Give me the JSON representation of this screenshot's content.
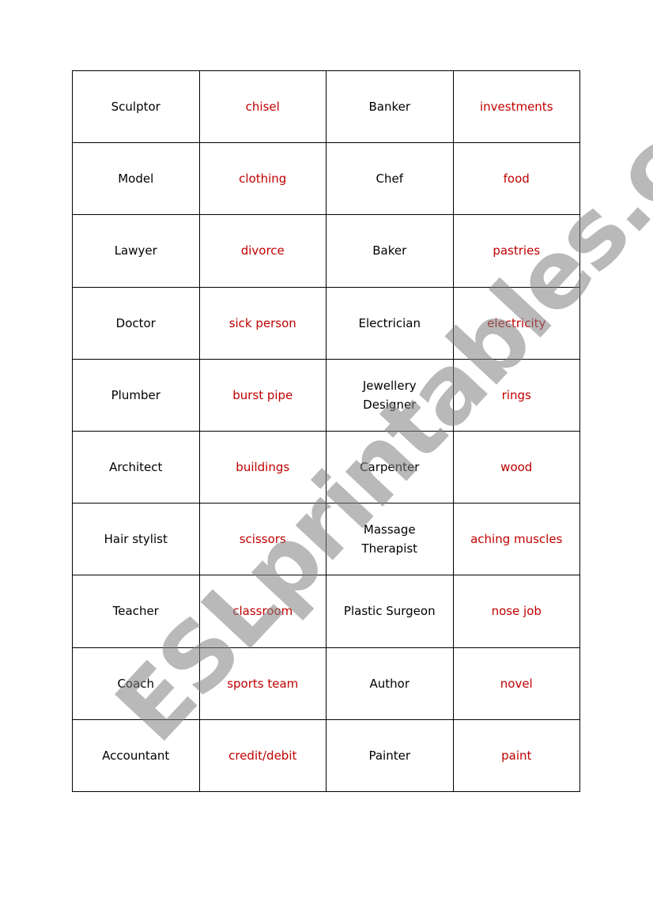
{
  "watermark": "ESLprintables.com",
  "colors": {
    "job_text": "#000000",
    "clue_text": "#c00000",
    "watermark": "#999999"
  },
  "rows": [
    {
      "job1": "Sculptor",
      "clue1": "chisel",
      "job2": "Banker",
      "clue2": "investments"
    },
    {
      "job1": "Model",
      "clue1": "clothing",
      "job2": "Chef",
      "clue2": "food"
    },
    {
      "job1": "Lawyer",
      "clue1": "divorce",
      "job2": "Baker",
      "clue2": "pastries"
    },
    {
      "job1": "Doctor",
      "clue1": "sick person",
      "job2": "Electrician",
      "clue2": "electricity"
    },
    {
      "job1": "Plumber",
      "clue1": "burst pipe",
      "job2": "Jewellery\nDesigner",
      "clue2": "rings"
    },
    {
      "job1": "Architect",
      "clue1": "buildings",
      "job2": "Carpenter",
      "clue2": "wood"
    },
    {
      "job1": "Hair stylist",
      "clue1": "scissors",
      "job2": "Massage\nTherapist",
      "clue2": "aching muscles"
    },
    {
      "job1": "Teacher",
      "clue1": "classroom",
      "job2": "Plastic Surgeon",
      "clue2": "nose job"
    },
    {
      "job1": "Coach",
      "clue1": "sports team",
      "job2": "Author",
      "clue2": "novel"
    },
    {
      "job1": "Accountant",
      "clue1": "credit/debit",
      "job2": "Painter",
      "clue2": "paint"
    }
  ]
}
